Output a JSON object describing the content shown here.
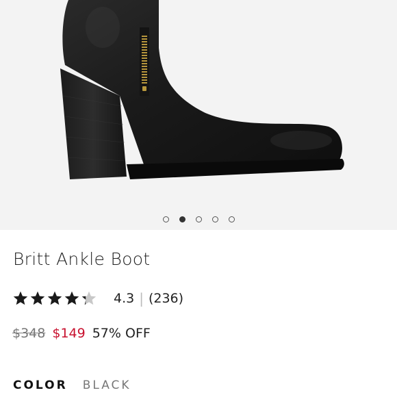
{
  "product": {
    "image_alt": "boot-product-image",
    "title": "Britt Ankle Boot",
    "rating": {
      "stars_filled": 4.3,
      "stars_total": 5,
      "value": "4.3",
      "separator": "|",
      "count": "(236)"
    },
    "price": {
      "original": "$348",
      "sale": "$149",
      "discount": "57% OFF"
    },
    "color": {
      "label": "COLOR",
      "value": "BLACK"
    }
  },
  "carousel": {
    "total": 5,
    "active_index": 1
  },
  "colors": {
    "sale_red": "#c8102e",
    "star": "#1a1a1a",
    "star_empty": "#c8c8c8",
    "hero_bg": "#f3f3f3"
  }
}
